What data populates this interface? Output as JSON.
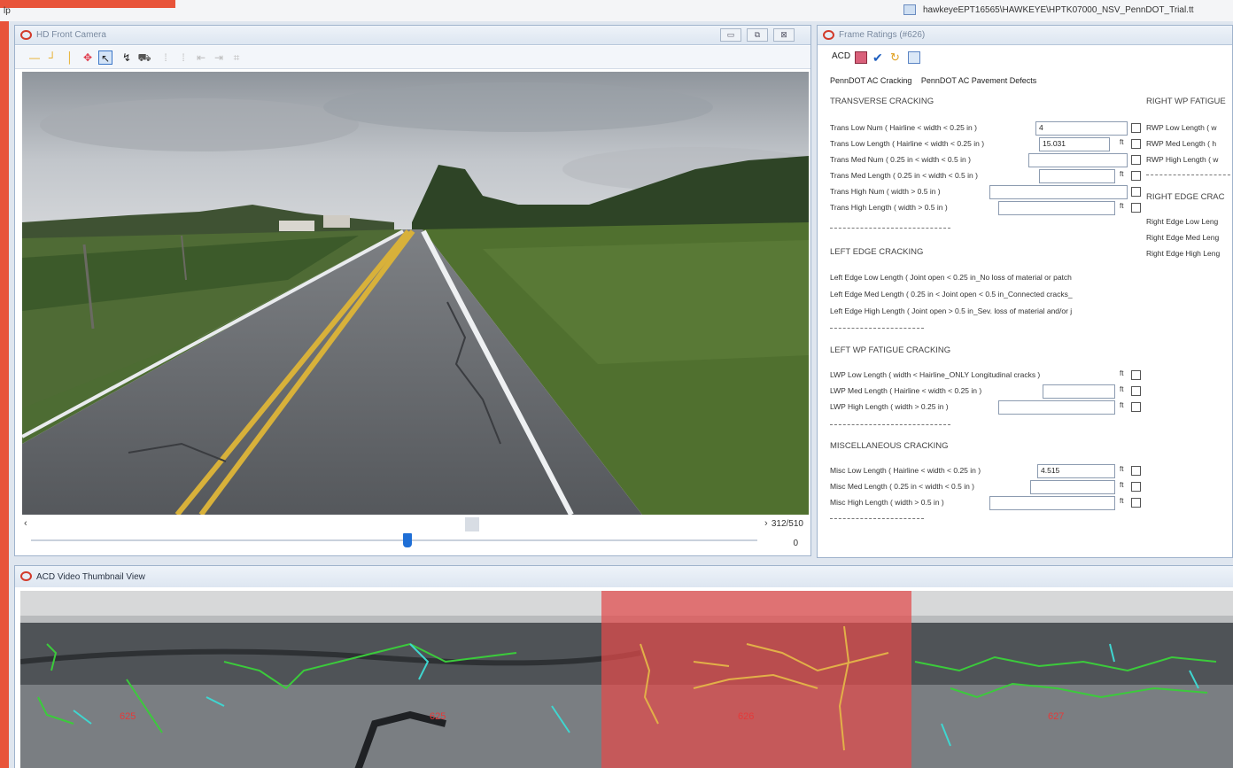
{
  "app": {
    "menu_help": "lp",
    "file_path": "hawkeyeEPT16565\\HAWKEYE\\HPTK07000_NSV_PennDOT_Trial.tt"
  },
  "video_panel": {
    "title": "HD Front Camera",
    "frame_counter": "312/510",
    "slider_value": "0",
    "scroll_left": "‹",
    "scroll_right": "›"
  },
  "ratings_panel": {
    "title": "Frame Ratings (#626)",
    "acd_label": "ACD",
    "subtabs": [
      "PennDOT AC Cracking",
      "PennDOT AC Pavement Defects"
    ],
    "sections": {
      "transverse": {
        "heading": "TRANSVERSE CRACKING",
        "rows": [
          {
            "label": "Trans Low Num ( Hairline < width < 0.25 in )",
            "value": "4",
            "unit": ""
          },
          {
            "label": "Trans Low Length ( Hairline < width < 0.25 in )",
            "value": "15.031",
            "unit": "ft"
          },
          {
            "label": "Trans Med Num ( 0.25 in < width < 0.5 in )",
            "value": "",
            "unit": ""
          },
          {
            "label": "Trans Med Length ( 0.25 in < width < 0.5 in )",
            "value": "",
            "unit": "ft"
          },
          {
            "label": "Trans High Num ( width > 0.5 in )",
            "value": "",
            "unit": ""
          },
          {
            "label": "Trans High Length ( width > 0.5 in )",
            "value": "",
            "unit": "ft"
          }
        ]
      },
      "left_edge": {
        "heading": "LEFT EDGE CRACKING",
        "rows": [
          {
            "label": "Left Edge Low Length ( Joint open < 0.25 in_No loss of material or patch"
          },
          {
            "label": "Left Edge Med Length ( 0.25 in < Joint open < 0.5 in_Connected cracks_"
          },
          {
            "label": "Left Edge High Length ( Joint open > 0.5 in_Sev. loss of material and/or j"
          }
        ]
      },
      "left_wp": {
        "heading": "LEFT WP FATIGUE CRACKING",
        "rows": [
          {
            "label": "LWP Low Length ( width < Hairline_ONLY Longitudinal cracks )",
            "value": "",
            "unit": "ft"
          },
          {
            "label": "LWP Med Length ( Hairline < width < 0.25 in )",
            "value": "",
            "unit": "ft"
          },
          {
            "label": "LWP High Length ( width > 0.25 in )",
            "value": "",
            "unit": "ft"
          }
        ]
      },
      "misc": {
        "heading": "MISCELLANEOUS CRACKING",
        "rows": [
          {
            "label": "Misc Low Length ( Hairline < width < 0.25 in )",
            "value": "4.515",
            "unit": "ft"
          },
          {
            "label": "Misc Med Length ( 0.25 in < width < 0.5 in )",
            "value": "",
            "unit": "ft"
          },
          {
            "label": "Misc High Length ( width > 0.5 in )",
            "value": "",
            "unit": "ft"
          }
        ]
      },
      "right_wp": {
        "heading": "RIGHT WP FATIGUE",
        "rows": [
          "RWP Low Length ( w",
          "RWP Med Length ( h",
          "RWP High Length ( w"
        ]
      },
      "right_edge": {
        "heading": "RIGHT EDGE CRAC",
        "rows": [
          "Right Edge Low Leng",
          "Right Edge Med Leng",
          "Right Edge High Leng"
        ]
      }
    }
  },
  "thumb_panel": {
    "title": "ACD Video Thumbnail View",
    "frame_labels": [
      "625",
      "625",
      "626",
      "627"
    ]
  }
}
